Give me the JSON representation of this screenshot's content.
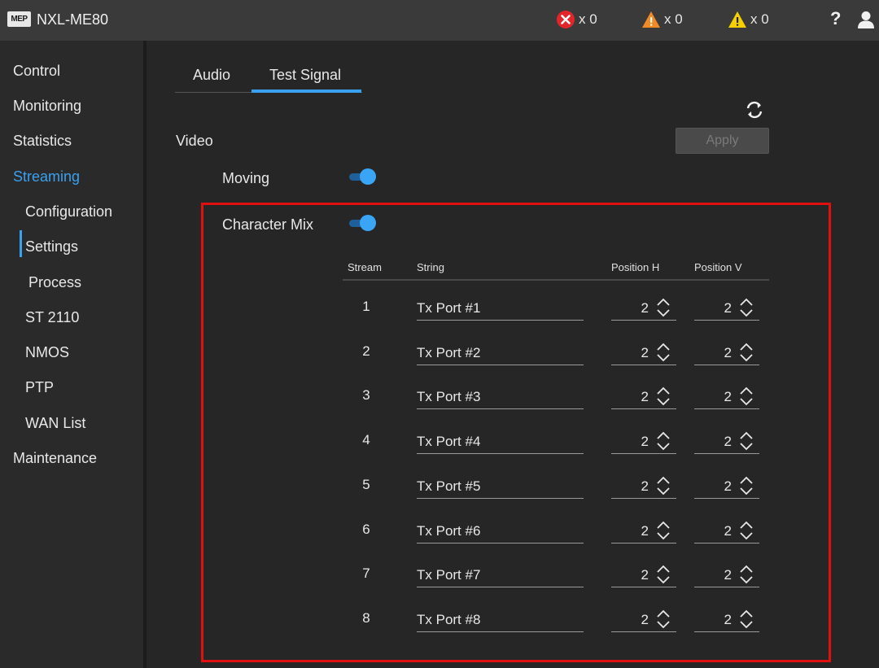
{
  "header": {
    "logo_text": "MEP",
    "title": "NXL-ME80",
    "status": [
      {
        "icon": "error-icon",
        "count": "x 0",
        "color": "#e0262b"
      },
      {
        "icon": "warning-orange-icon",
        "count": "x 0",
        "color": "#f08a24"
      },
      {
        "icon": "warning-yellow-icon",
        "count": "x 0",
        "color": "#f5d000"
      }
    ],
    "help_label": "?"
  },
  "sidebar": {
    "items": [
      {
        "label": "Control"
      },
      {
        "label": "Monitoring"
      },
      {
        "label": "Statistics"
      },
      {
        "label": "Streaming"
      },
      {
        "label": "Configuration"
      },
      {
        "label": "Settings"
      },
      {
        "label": "Process"
      },
      {
        "label": "ST 2110"
      },
      {
        "label": "NMOS"
      },
      {
        "label": "PTP"
      },
      {
        "label": "WAN List"
      },
      {
        "label": "Maintenance"
      }
    ],
    "active": "Streaming",
    "selected_sub": "Process"
  },
  "tabs": [
    {
      "label": "Audio"
    },
    {
      "label": "Test Signal"
    }
  ],
  "active_tab": "Test Signal",
  "apply_label": "Apply",
  "video_label": "Video",
  "moving": {
    "label": "Moving",
    "on": true
  },
  "character_mix": {
    "label": "Character Mix",
    "on": true
  },
  "table": {
    "headers": {
      "stream": "Stream",
      "string": "String",
      "position_h": "Position H",
      "position_v": "Position V"
    },
    "rows": [
      {
        "stream": "1",
        "string": "Tx Port #1",
        "position_h": "2",
        "position_v": "2"
      },
      {
        "stream": "2",
        "string": "Tx Port #2",
        "position_h": "2",
        "position_v": "2"
      },
      {
        "stream": "3",
        "string": "Tx Port #3",
        "position_h": "2",
        "position_v": "2"
      },
      {
        "stream": "4",
        "string": "Tx Port #4",
        "position_h": "2",
        "position_v": "2"
      },
      {
        "stream": "5",
        "string": "Tx Port #5",
        "position_h": "2",
        "position_v": "2"
      },
      {
        "stream": "6",
        "string": "Tx Port #6",
        "position_h": "2",
        "position_v": "2"
      },
      {
        "stream": "7",
        "string": "Tx Port #7",
        "position_h": "2",
        "position_v": "2"
      },
      {
        "stream": "8",
        "string": "Tx Port #8",
        "position_h": "2",
        "position_v": "2"
      }
    ]
  },
  "colors": {
    "accent": "#3aa0f0",
    "highlight": "#e01010"
  }
}
